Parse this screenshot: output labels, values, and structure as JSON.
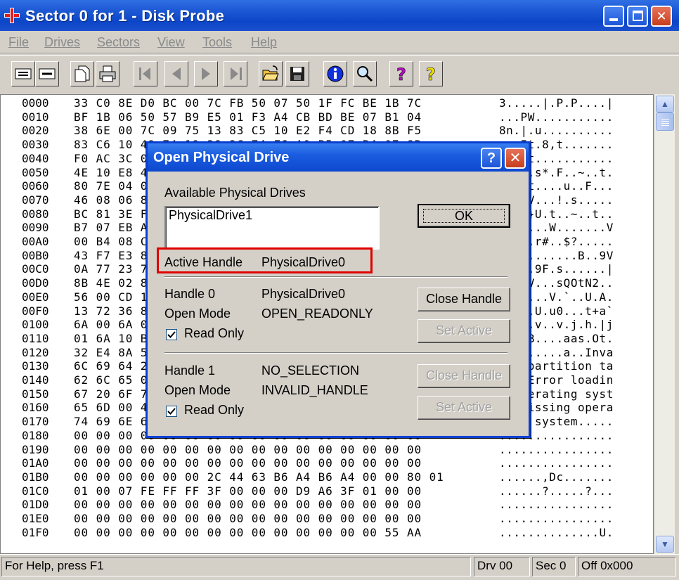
{
  "window": {
    "title": "Sector 0 for 1 - Disk Probe",
    "min_label": "_",
    "max_label": "",
    "close_label": "✕"
  },
  "menu": [
    "File",
    "Drives",
    "Sectors",
    "View",
    "Tools",
    "Help"
  ],
  "toolbar_icons": [
    "document-icon",
    "document-icon",
    "copy-icon",
    "print-icon",
    "first-icon",
    "prev-icon",
    "next-icon",
    "last-icon",
    "open-folder-icon",
    "save-icon",
    "info-icon",
    "search-icon",
    "help-icon",
    "context-help-icon"
  ],
  "hex": {
    "rows": [
      {
        "off": "0000",
        "bytes": "33 C0 8E D0 BC 00 7C FB 50 07 50 1F FC BE 1B 7C",
        "ascii": "3.....|.P.P....|"
      },
      {
        "off": "0010",
        "bytes": "BF 1B 06 50 57 B9 E5 01 F3 A4 CB BD BE 07 B1 04",
        "ascii": "...PW..........."
      },
      {
        "off": "0020",
        "bytes": "38 6E 00 7C 09 75 13 83 C5 10 E2 F4 CD 18 8B F5",
        "ascii": "8n.|.u.........."
      },
      {
        "off": "0030",
        "bytes": "83 C6 10 49 74 19 38 2C 74 F6 A0 B5 07 B4 07 8B",
        "ascii": "...It.8,t......."
      },
      {
        "off": "0040",
        "bytes": "F0 AC 3C 00 74 FC BB 07 00 B4 0E CD 10 EB F2 88",
        "ascii": "..<.t..........."
      },
      {
        "off": "0050",
        "bytes": "4E 10 E8 46 00 73 2A FE 46 10 80 7E 04 0B 74 0B",
        "ascii": "N..F.s*.F..~..t."
      },
      {
        "off": "0060",
        "bytes": "80 7E 04 0C 74 05 A0 B6 07 75 D2 80 46 02 06 83",
        "ascii": ".~..t....u..F..."
      },
      {
        "off": "0070",
        "bytes": "46 08 06 83 56 0A 00 E8 21 00 73 05 A0 B6 07 EB",
        "ascii": "F...V...!.s....."
      },
      {
        "off": "0080",
        "bytes": "BC 81 3E FE 7D 55 AA 74 0B 80 7E 10 00 74 C8 A0",
        "ascii": "..>.}U.t..~..t.."
      },
      {
        "off": "0090",
        "bytes": "B7 07 EB A9 8B FC 1E 57 8B F5 CB BF 05 00 8A 56",
        "ascii": ".......W.......V"
      },
      {
        "off": "00A0",
        "bytes": "00 B4 08 CD 13 72 23 8A C1 24 3F 98 8A DE 8A FC",
        "ascii": ".....r#..$?....."
      },
      {
        "off": "00B0",
        "bytes": "43 F7 E3 8B D1 86 D6 B1 06 D2 EE 42 F7 E2 39 56",
        "ascii": "C..........B..9V"
      },
      {
        "off": "00C0",
        "bytes": "0A 77 23 72 05 39 46 08 73 1C B8 01 02 BB 00 7C",
        "ascii": ".w#r.9F.s......|"
      },
      {
        "off": "00D0",
        "bytes": "8B 4E 02 8B 56 00 CD 13 73 51 4F 74 4E 32 E4 8A",
        "ascii": ".N..V...sQOtN2.."
      },
      {
        "off": "00E0",
        "bytes": "56 00 CD 13 EB E4 8A 56 00 60 BB AA 55 B4 41 CD",
        "ascii": "V......V.`..U.A."
      },
      {
        "off": "00F0",
        "bytes": "13 72 36 81 FB 55 AA 75 30 F6 C1 01 74 2B 61 60",
        "ascii": ".r6..U.u0...t+a`"
      },
      {
        "off": "0100",
        "bytes": "6A 00 6A 00 FF 76 0A FF 76 08 6A 00 68 00 7C 6A",
        "ascii": "j.j..v..v.j.h.|j"
      },
      {
        "off": "0110",
        "bytes": "01 6A 10 B4 42 8B F4 CD 13 61 61 73 0E 4F 74 0B",
        "ascii": ".j..B....aas.Ot."
      },
      {
        "off": "0120",
        "bytes": "32 E4 8A 56 00 CD 13 EB D6 61 F9 C3 49 6E 76 61",
        "ascii": "2..V.....a..Inva"
      },
      {
        "off": "0130",
        "bytes": "6C 69 64 20 70 61 72 74 69 74 69 6F 6E 20 74 61",
        "ascii": "lid partition ta"
      },
      {
        "off": "0140",
        "bytes": "62 6C 65 00 45 72 72 6F 72 20 6C 6F 61 64 69 6E",
        "ascii": "ble.Error loadin"
      },
      {
        "off": "0150",
        "bytes": "67 20 6F 70 65 72 61 74 69 6E 67 20 73 79 73 74",
        "ascii": "g operating syst"
      },
      {
        "off": "0160",
        "bytes": "65 6D 00 4D 69 73 73 69 6E 67 20 6F 70 65 72 61",
        "ascii": "em.Missing opera"
      },
      {
        "off": "0170",
        "bytes": "74 69 6E 67 20 73 79 73 74 65 6D 00 00 00 00 00",
        "ascii": "ting system....."
      },
      {
        "off": "0180",
        "bytes": "00 00 00 00 00 00 00 00 00 00 00 00 00 00 00 00",
        "ascii": "................"
      },
      {
        "off": "0190",
        "bytes": "00 00 00 00 00 00 00 00 00 00 00 00 00 00 00 00",
        "ascii": "................"
      },
      {
        "off": "01A0",
        "bytes": "00 00 00 00 00 00 00 00 00 00 00 00 00 00 00 00",
        "ascii": "................"
      },
      {
        "off": "01B0",
        "bytes": "00 00 00 00 00 00 2C 44 63 B6 A4 B6 A4 00 00 80 01",
        "ascii": "......,Dc......."
      },
      {
        "off": "01C0",
        "bytes": "01 00 07 FE FF FF 3F 00 00 00 D9 A6 3F 01 00 00",
        "ascii": "......?.....?..."
      },
      {
        "off": "01D0",
        "bytes": "00 00 00 00 00 00 00 00 00 00 00 00 00 00 00 00",
        "ascii": "................"
      },
      {
        "off": "01E0",
        "bytes": "00 00 00 00 00 00 00 00 00 00 00 00 00 00 00 00",
        "ascii": "................"
      },
      {
        "off": "01F0",
        "bytes": "00 00 00 00 00 00 00 00 00 00 00 00 00 00 55 AA",
        "ascii": "..............U."
      }
    ]
  },
  "status": {
    "help": "For Help, press F1",
    "drive": "Drv 00",
    "sector": "Sec 0",
    "offset": "Off 0x000"
  },
  "dialog": {
    "title": "Open Physical Drive",
    "help_label": "?",
    "close_label": "✕",
    "available_label": "Available Physical Drives",
    "drives": [
      "PhysicalDrive1"
    ],
    "ok_label": "OK",
    "active_handle_label": "Active Handle",
    "active_handle_value": "PhysicalDrive0",
    "handle0": {
      "label": "Handle 0",
      "value": "PhysicalDrive0",
      "mode_label": "Open Mode",
      "mode_value": "OPEN_READONLY",
      "readonly_label": "Read Only",
      "readonly_checked": true,
      "close_label": "Close Handle",
      "set_active_label": "Set Active"
    },
    "handle1": {
      "label": "Handle 1",
      "value": "NO_SELECTION",
      "mode_label": "Open Mode",
      "mode_value": "INVALID_HANDLE",
      "readonly_label": "Read Only",
      "readonly_checked": true,
      "close_label": "Close Handle",
      "set_active_label": "Set Active"
    }
  }
}
